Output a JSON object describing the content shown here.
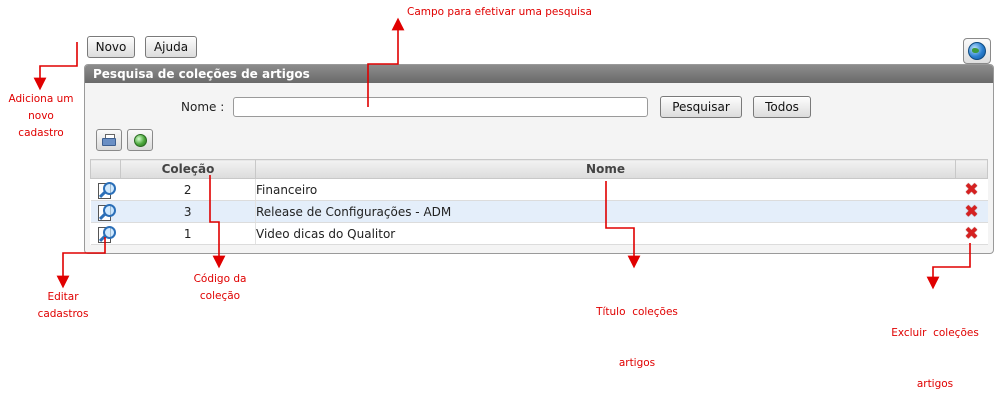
{
  "toolbar": {
    "new_label": "Novo",
    "help_label": "Ajuda"
  },
  "help_icon": "globe-help-icon",
  "panel": {
    "title": "Pesquisa de coleções de artigos",
    "name_label": "Nome :",
    "search_value": "",
    "search_button": "Pesquisar",
    "all_button": "Todos",
    "tool_icons": [
      "printer-icon",
      "export-globe-icon"
    ]
  },
  "table": {
    "headers": {
      "code": "Coleção",
      "name": "Nome"
    },
    "rows": [
      {
        "code": "2",
        "name": "Financeiro"
      },
      {
        "code": "3",
        "name": "Release de Configurações - ADM"
      },
      {
        "code": "1",
        "name": "Video dicas do Qualitor"
      }
    ]
  },
  "annotations": {
    "search_field": "Campo para efetivar uma pesquisa",
    "new_record": [
      "Adiciona um",
      "novo",
      "cadastro"
    ],
    "edit": [
      "Editar",
      "cadastros"
    ],
    "code": [
      "Código da",
      "coleção"
    ],
    "title": [
      "Título  coleções",
      "artigos"
    ],
    "delete": [
      "Excluir  coleções",
      "artigos"
    ]
  },
  "colors": {
    "annotation": "#e00000",
    "header_bar": "#7a7a7a",
    "row_highlight": "#e4eefa"
  }
}
